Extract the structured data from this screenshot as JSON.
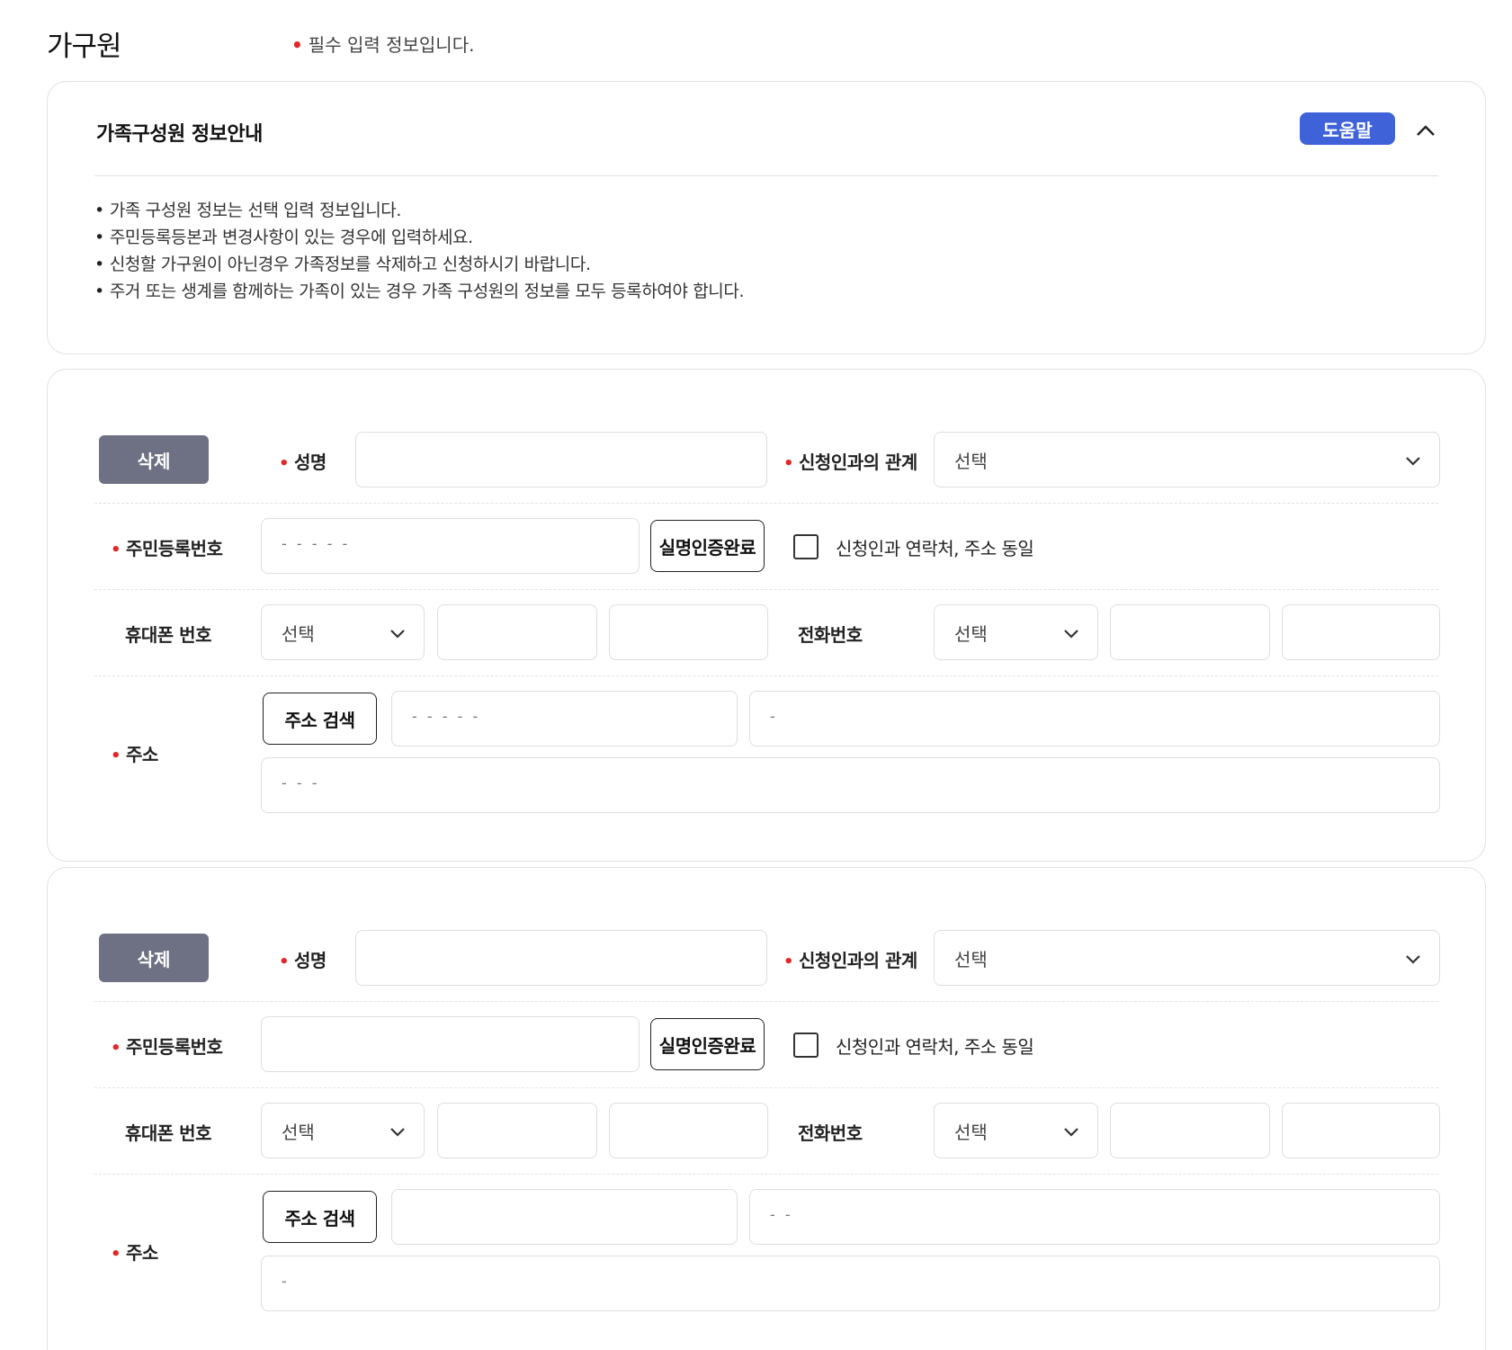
{
  "page": {
    "title": "가구원",
    "required_note": "필수 입력 정보입니다."
  },
  "info": {
    "title": "가족구성원 정보안내",
    "help_label": "도움말",
    "items": [
      "가족 구성원 정보는 선택 입력 정보입니다.",
      "주민등록등본과 변경사항이 있는 경우에 입력하세요.",
      "신청할 가구원이 아닌경우 가족정보를 삭제하고 신청하시기 바랍니다.",
      "주거 또는 생계를 함께하는 가족이 있는 경우 가족 구성원의 정보를 모두 등록하여야 합니다."
    ]
  },
  "labels": {
    "delete": "삭제",
    "name": "성명",
    "relation": "신청인과의 관계",
    "select": "선택",
    "rrn": "주민등록번호",
    "verify_done": "실명인증완료",
    "same_as_applicant": "신청인과 연락처, 주소 동일",
    "mobile": "휴대폰 번호",
    "phone": "전화번호",
    "address": "주소",
    "address_search": "주소 검색"
  },
  "members": [
    {
      "rrn_value": "- - - - -",
      "zip_value": "- - - - -",
      "addr1_value": "-",
      "addr2_value": "- - -"
    },
    {
      "rrn_value": "",
      "zip_value": "",
      "addr1_value": "- -",
      "addr2_value": "-"
    }
  ],
  "colors": {
    "accent": "#3f62d8",
    "required": "#e02828",
    "delete_button": "#6e7183"
  }
}
